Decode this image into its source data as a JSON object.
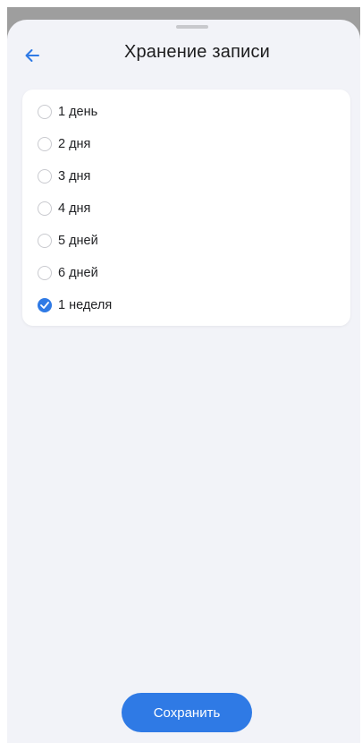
{
  "header": {
    "title": "Хранение записи",
    "back_icon": "arrow-left-icon"
  },
  "options": [
    {
      "label": "1 день",
      "selected": false
    },
    {
      "label": "2 дня",
      "selected": false
    },
    {
      "label": "3 дня",
      "selected": false
    },
    {
      "label": "4 дня",
      "selected": false
    },
    {
      "label": "5 дней",
      "selected": false
    },
    {
      "label": "6 дней",
      "selected": false
    },
    {
      "label": "1 неделя",
      "selected": true
    }
  ],
  "footer": {
    "save_label": "Сохранить"
  },
  "colors": {
    "accent": "#2f7ae5",
    "sheet_background": "#f2f3f8",
    "card_background": "#ffffff",
    "text": "#1c1c1e"
  }
}
